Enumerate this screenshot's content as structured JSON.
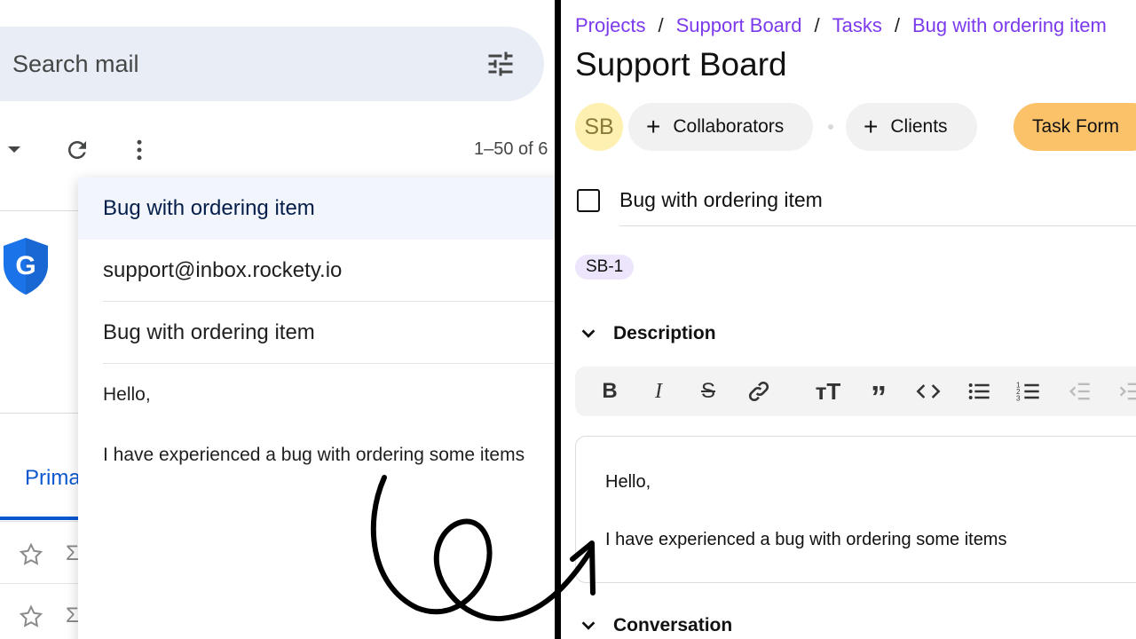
{
  "mail": {
    "search_placeholder": "Search mail",
    "pager": "1–50 of 6",
    "tab_primary": "Prima",
    "popup": {
      "header_subject": "Bug with ordering item",
      "from": "support@inbox.rockety.io",
      "subject": "Bug with ordering item",
      "greeting": "Hello,",
      "body": "I have experienced a bug with ordering some items"
    }
  },
  "board": {
    "breadcrumbs": [
      "Projects",
      "Support Board",
      "Tasks",
      "Bug with ordering item"
    ],
    "title": "Support Board",
    "avatar_initials": "SB",
    "collaborators_label": "Collaborators",
    "clients_label": "Clients",
    "task_form_label": "Task Form",
    "task_title": "Bug with ordering item",
    "task_tag": "SB-1",
    "description_heading": "Description",
    "conversation_heading": "Conversation",
    "editor_greeting": "Hello,",
    "editor_body": "I have experienced a bug with ordering some items"
  },
  "colors": {
    "accent_purple": "#7c3aed",
    "task_form_bg": "#fbc26a",
    "avatar_bg": "#fdf0b0",
    "mail_blue": "#0b57d0",
    "search_bg": "#e9eef6"
  },
  "icons": {
    "editor_toolbar": [
      "bold-icon",
      "italic-icon",
      "strikethrough-icon",
      "link-icon",
      "text-size-icon",
      "quote-icon",
      "code-icon",
      "bullet-list-icon",
      "numbered-list-icon",
      "outdent-icon",
      "indent-icon"
    ]
  }
}
